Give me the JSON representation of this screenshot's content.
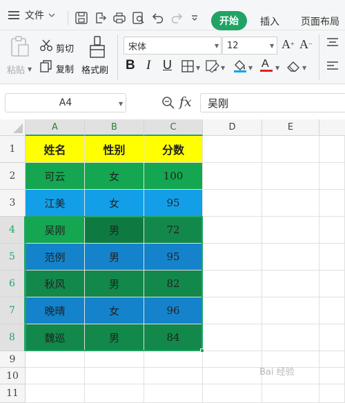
{
  "menubar": {
    "file_label": "文件",
    "tabs": [
      {
        "label": "开始",
        "active": true
      },
      {
        "label": "插入",
        "active": false
      },
      {
        "label": "页面布局",
        "active": false
      }
    ]
  },
  "ribbon": {
    "paste_label": "粘贴",
    "cut_label": "剪切",
    "copy_label": "复制",
    "format_painter_label": "格式刷",
    "font_name": "宋体",
    "font_size": "12"
  },
  "formula_bar": {
    "name_box": "A4",
    "fx_label": "fx",
    "value": "吴刚"
  },
  "columns": [
    "A",
    "B",
    "C",
    "D",
    "E"
  ],
  "rows": [
    "1",
    "2",
    "3",
    "4",
    "5",
    "6",
    "7",
    "8",
    "9",
    "10",
    "11"
  ],
  "table": {
    "header": [
      "姓名",
      "性别",
      "分数"
    ],
    "data": [
      [
        "可云",
        "女",
        "100"
      ],
      [
        "江美",
        "女",
        "95"
      ],
      [
        "吴刚",
        "男",
        "72"
      ],
      [
        "范例",
        "男",
        "95"
      ],
      [
        "秋风",
        "男",
        "82"
      ],
      [
        "晚晴",
        "女",
        "96"
      ],
      [
        "魏巡",
        "男",
        "84"
      ]
    ]
  },
  "colors": {
    "header_fill": "#ffff00",
    "fill_green": "#14a651",
    "fill_blue": "#139fe8",
    "selected_green": "#12884a",
    "selected_blue": "#1483cc",
    "cell_b4": "#0e7a42",
    "accent": "#21a366"
  },
  "selection": {
    "active_cell": "A4",
    "range": "A4:C8"
  },
  "watermark": "Bai 经验"
}
